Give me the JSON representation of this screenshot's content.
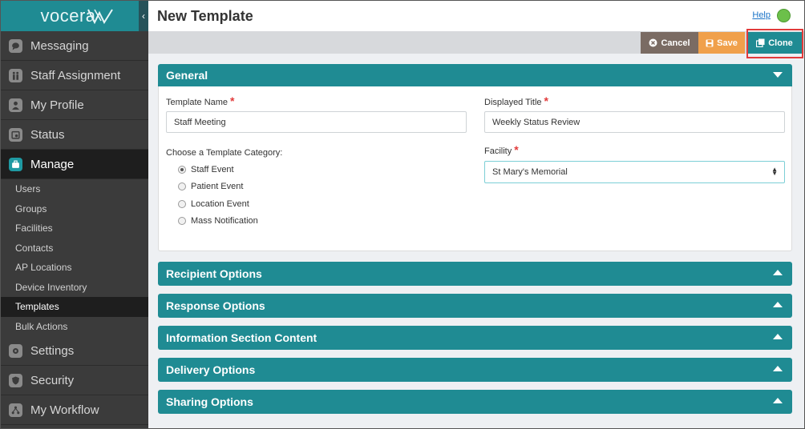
{
  "app": {
    "logo_text": "vocera",
    "collapse_glyph": "‹"
  },
  "sidebar": {
    "items": [
      {
        "label": "Messaging",
        "icon": "chat-icon"
      },
      {
        "label": "Staff Assignment",
        "icon": "staff-icon"
      },
      {
        "label": "My Profile",
        "icon": "profile-icon"
      },
      {
        "label": "Status",
        "icon": "status-icon"
      },
      {
        "label": "Manage",
        "icon": "briefcase-icon",
        "active": true
      }
    ],
    "sub_items": [
      "Users",
      "Groups",
      "Facilities",
      "Contacts",
      "AP Locations",
      "Device Inventory",
      "Templates",
      "Bulk Actions"
    ],
    "active_sub": "Templates",
    "bottom_items": [
      {
        "label": "Settings",
        "icon": "gear-icon"
      },
      {
        "label": "Security",
        "icon": "shield-icon"
      },
      {
        "label": "My Workflow",
        "icon": "workflow-icon"
      }
    ]
  },
  "header": {
    "title": "New Template",
    "help_label": "Help",
    "status_color": "#6cc04a"
  },
  "toolbar": {
    "cancel_label": "Cancel",
    "save_label": "Save",
    "clone_label": "Clone"
  },
  "general": {
    "title": "General",
    "template_name_label": "Template Name",
    "template_name_value": "Staff Meeting",
    "displayed_title_label": "Displayed Title",
    "displayed_title_value": "Weekly Status Review",
    "category_label": "Choose a Template Category:",
    "categories": [
      {
        "label": "Staff Event",
        "checked": true
      },
      {
        "label": "Patient Event",
        "checked": false
      },
      {
        "label": "Location Event",
        "checked": false
      },
      {
        "label": "Mass Notification",
        "checked": false
      }
    ],
    "facility_label": "Facility",
    "facility_value": "St Mary's Memorial",
    "required_mark": "*"
  },
  "sections": [
    "Recipient Options",
    "Response Options",
    "Information Section Content",
    "Delivery Options",
    "Sharing Options"
  ],
  "colors": {
    "accent": "#1f8b93",
    "sidebar": "#3b3b3b",
    "cancel": "#7a6b63",
    "save": "#f0a04b",
    "required": "#e23b3b",
    "highlight": "#e23b3b"
  }
}
